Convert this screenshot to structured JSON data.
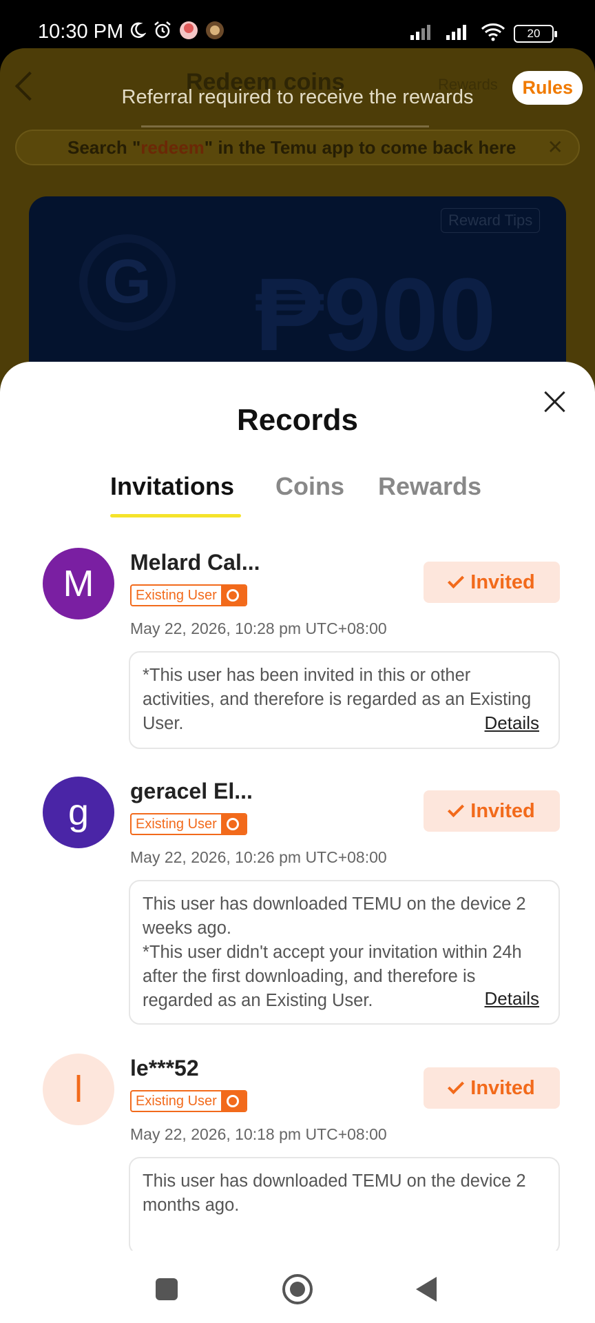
{
  "status_bar": {
    "time": "10:30 PM",
    "battery": "20"
  },
  "background": {
    "title": "Redeem coins",
    "title_right": "Rewards",
    "rules_label": "Rules",
    "notice": "Referral required to receive the rewards",
    "search_prefix": "Search \"",
    "search_keyword": "redeem",
    "search_suffix": "\" in the Temu app to come back here",
    "card_tips": "Reward Tips",
    "card_amount": "₱900"
  },
  "sheet": {
    "title": "Records",
    "tabs": [
      {
        "label": "Invitations"
      },
      {
        "label": "Coins"
      },
      {
        "label": "Rewards"
      }
    ]
  },
  "records": [
    {
      "avatar_letter": "M",
      "avatar_color": "#7a1fa2",
      "name": "Melard Cal...",
      "badge": "Existing User",
      "time": "May 22, 2026, 10:28 pm UTC+08:00",
      "status": "Invited",
      "note_lines": [
        "*This user has been invited in this or other activities, and therefore is regarded as an Existing User."
      ],
      "details_label": "Details"
    },
    {
      "avatar_letter": "g",
      "avatar_color": "#4a25a6",
      "name": "geracel El...",
      "badge": "Existing User",
      "time": "May 22, 2026, 10:26 pm UTC+08:00",
      "status": "Invited",
      "note_lines": [
        "This user has downloaded TEMU on the device 2 weeks ago.",
        "*This user didn't accept your invitation within 24h after the first downloading, and therefore is regarded as an Existing User."
      ],
      "details_label": "Details"
    },
    {
      "avatar_letter": "l",
      "avatar_color": "#fde6dc",
      "avatar_text_color": "#f26a1b",
      "name": "le***52",
      "badge": "Existing User",
      "time": "May 22, 2026, 10:18 pm UTC+08:00",
      "status": "Invited",
      "note_lines": [
        "This user has downloaded TEMU on the device 2 months ago."
      ]
    }
  ]
}
